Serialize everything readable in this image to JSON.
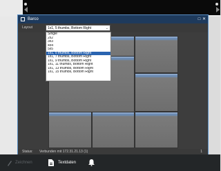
{
  "window": {
    "title": "Barco",
    "minimize_glyph": "–",
    "maximize_glyph": "□",
    "close_glyph": "✕"
  },
  "layout_control": {
    "label": "Layout",
    "selected": "1x1, 5 thumbs, Bottom Right",
    "caret": "⌄",
    "options": [
      "Single",
      "2x2",
      "3x3",
      "4x4",
      "5x5",
      "1x1, 5 thumbs, Bottom Right",
      "1x1, 7 thumbs, Bottom Right",
      "1x1, 9 thumbs, Bottom Right",
      "1x1, 11 thumbs, Bottom Right",
      "1x1, 13 thumbs, Bottom Right",
      "1x1, 15 thumbs, Bottom Right"
    ],
    "highlighted_index": 5
  },
  "status": {
    "label": "Status:",
    "value": "Verbunden mit 172.31.21.13 (1)",
    "count": "1"
  },
  "taskbar": {
    "items": [
      {
        "label": "Zeichnen",
        "icon": "brush-icon",
        "enabled": false
      },
      {
        "label": "Textdaten",
        "icon": "document-icon",
        "enabled": true
      },
      {
        "label": "",
        "icon": "bell-icon",
        "enabled": true
      }
    ]
  },
  "colors": {
    "title_bar": "#1e3a5c",
    "selection": "#2a64b0",
    "window_border": "#5a8fc4",
    "taskbar": "#232628"
  }
}
